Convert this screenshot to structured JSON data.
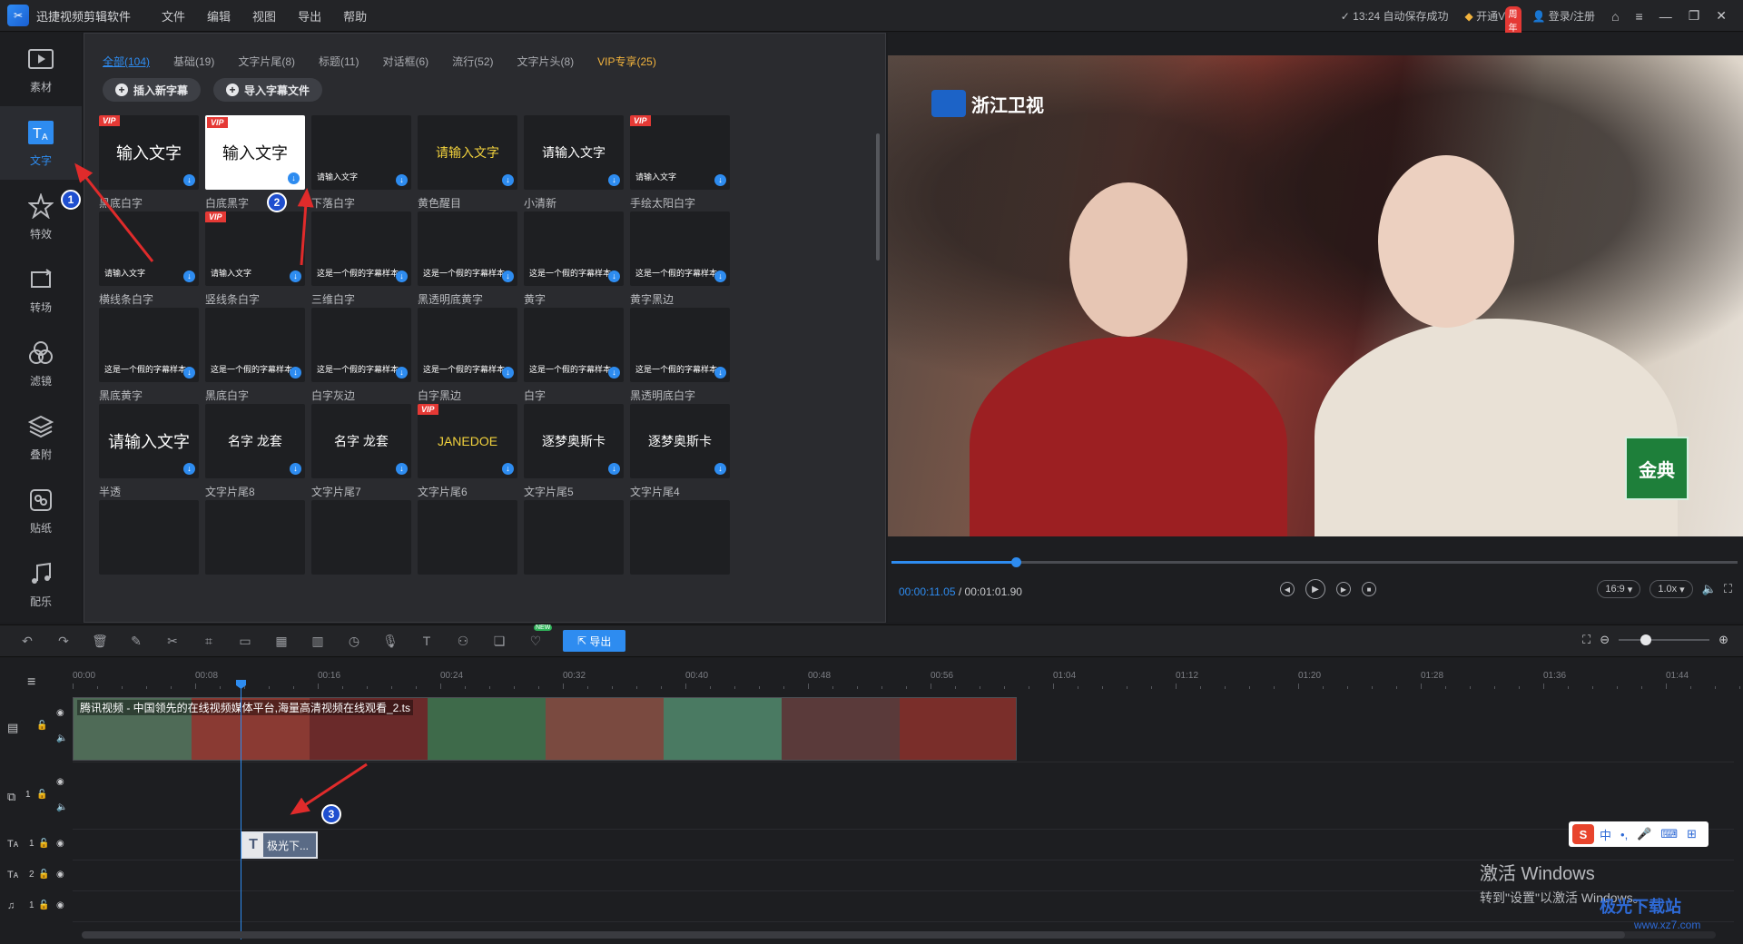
{
  "app": {
    "title": "迅捷视频剪辑软件",
    "menu": [
      "文件",
      "编辑",
      "视图",
      "导出",
      "帮助"
    ],
    "autosave": "13:24 自动保存成功",
    "vip_label": "开通VIP",
    "vip_promo": "周年大促",
    "login": "登录/注册"
  },
  "sidebar": [
    {
      "label": "素材",
      "icon": "media-icon"
    },
    {
      "label": "文字",
      "icon": "text-icon"
    },
    {
      "label": "特效",
      "icon": "effects-icon"
    },
    {
      "label": "转场",
      "icon": "transition-icon"
    },
    {
      "label": "滤镜",
      "icon": "filter-icon"
    },
    {
      "label": "叠附",
      "icon": "overlay-icon"
    },
    {
      "label": "贴纸",
      "icon": "sticker-icon"
    },
    {
      "label": "配乐",
      "icon": "music-icon"
    }
  ],
  "library": {
    "tabs": [
      "全部(104)",
      "基础(19)",
      "文字片尾(8)",
      "标题(11)",
      "对话框(6)",
      "流行(52)",
      "文字片头(8)",
      "VIP专享(25)"
    ],
    "insert_btn": "插入新字幕",
    "import_btn": "导入字幕文件",
    "items": [
      {
        "label": "黑底白字",
        "sample": "输入文字",
        "vip": true,
        "style": "big"
      },
      {
        "label": "白底黑字",
        "sample": "输入文字",
        "vip": true,
        "style": "white"
      },
      {
        "label": "下落白字",
        "sample": "请输入文字",
        "vip": false,
        "style": "small"
      },
      {
        "label": "黄色醒目",
        "sample": "请输入文字",
        "vip": false,
        "style": "yellow"
      },
      {
        "label": "小清新",
        "sample": "请输入文字",
        "vip": false,
        "style": "mid"
      },
      {
        "label": "手绘太阳白字",
        "sample": "请输入文字",
        "vip": true,
        "style": "small"
      },
      {
        "label": "横线条白字",
        "sample": "请输入文字",
        "vip": false,
        "style": "small"
      },
      {
        "label": "竖线条白字",
        "sample": "请输入文字",
        "vip": true,
        "style": "small"
      },
      {
        "label": "三维白字",
        "sample": "这是一个假的字幕样本",
        "vip": false,
        "style": "small"
      },
      {
        "label": "黑透明底黄字",
        "sample": "这是一个假的字幕样本",
        "vip": false,
        "style": "small"
      },
      {
        "label": "黄字",
        "sample": "这是一个假的字幕样本",
        "vip": false,
        "style": "small"
      },
      {
        "label": "黄字黑边",
        "sample": "这是一个假的字幕样本",
        "vip": false,
        "style": "small"
      },
      {
        "label": "黑底黄字",
        "sample": "这是一个假的字幕样本",
        "vip": false,
        "style": "small"
      },
      {
        "label": "黑底白字",
        "sample": "这是一个假的字幕样本",
        "vip": false,
        "style": "small"
      },
      {
        "label": "白字灰边",
        "sample": "这是一个假的字幕样本",
        "vip": false,
        "style": "small"
      },
      {
        "label": "白字黑边",
        "sample": "这是一个假的字幕样本",
        "vip": false,
        "style": "small"
      },
      {
        "label": "白字",
        "sample": "这是一个假的字幕样本",
        "vip": false,
        "style": "small"
      },
      {
        "label": "黑透明底白字",
        "sample": "这是一个假的字幕样本",
        "vip": false,
        "style": "small"
      },
      {
        "label": "半透",
        "sample": "请输入文字",
        "vip": false,
        "style": "big"
      },
      {
        "label": "文字片尾8",
        "sample": "名字 龙套",
        "vip": false,
        "style": "mid"
      },
      {
        "label": "文字片尾7",
        "sample": "名字 龙套",
        "vip": false,
        "style": "mid"
      },
      {
        "label": "文字片尾6",
        "sample": "JANEDOE",
        "vip": true,
        "style": "yellow"
      },
      {
        "label": "文字片尾5",
        "sample": "逐梦奥斯卡",
        "vip": false,
        "style": "mid"
      },
      {
        "label": "文字片尾4",
        "sample": "逐梦奥斯卡",
        "vip": false,
        "style": "mid"
      }
    ]
  },
  "preview": {
    "channel": "浙江卫视",
    "brand": "金典",
    "current_time": "00:00:11.05",
    "total_time": "/ 00:01:01.90",
    "progress": 0.147,
    "ratio": "16:9",
    "speed": "1.0x"
  },
  "toolbar": {
    "export": "导出",
    "new_badge": "NEW"
  },
  "timeline": {
    "ticks": [
      "00:00",
      "00:08",
      "00:16",
      "00:24",
      "00:32",
      "00:40",
      "00:48",
      "00:56",
      "01:04",
      "01:12",
      "01:20",
      "01:28",
      "01:36",
      "01:44"
    ],
    "video_clip_title": "腾讯视频 - 中国领先的在线视频媒体平台,海量高清视频在线观看_2.ts",
    "text_clip": "极光下...",
    "track_labels": [
      "1",
      "1",
      "1",
      "2",
      "1"
    ]
  },
  "annotations": [
    "1",
    "2",
    "3"
  ],
  "overlay": {
    "ime": [
      "中",
      "•,",
      "🎤",
      "⌨",
      "⊞"
    ],
    "activate_title": "激活 Windows",
    "activate_sub": "转到\"设置\"以激活 Windows。",
    "site": "极光下载站",
    "site_url": "www.xz7.com"
  }
}
